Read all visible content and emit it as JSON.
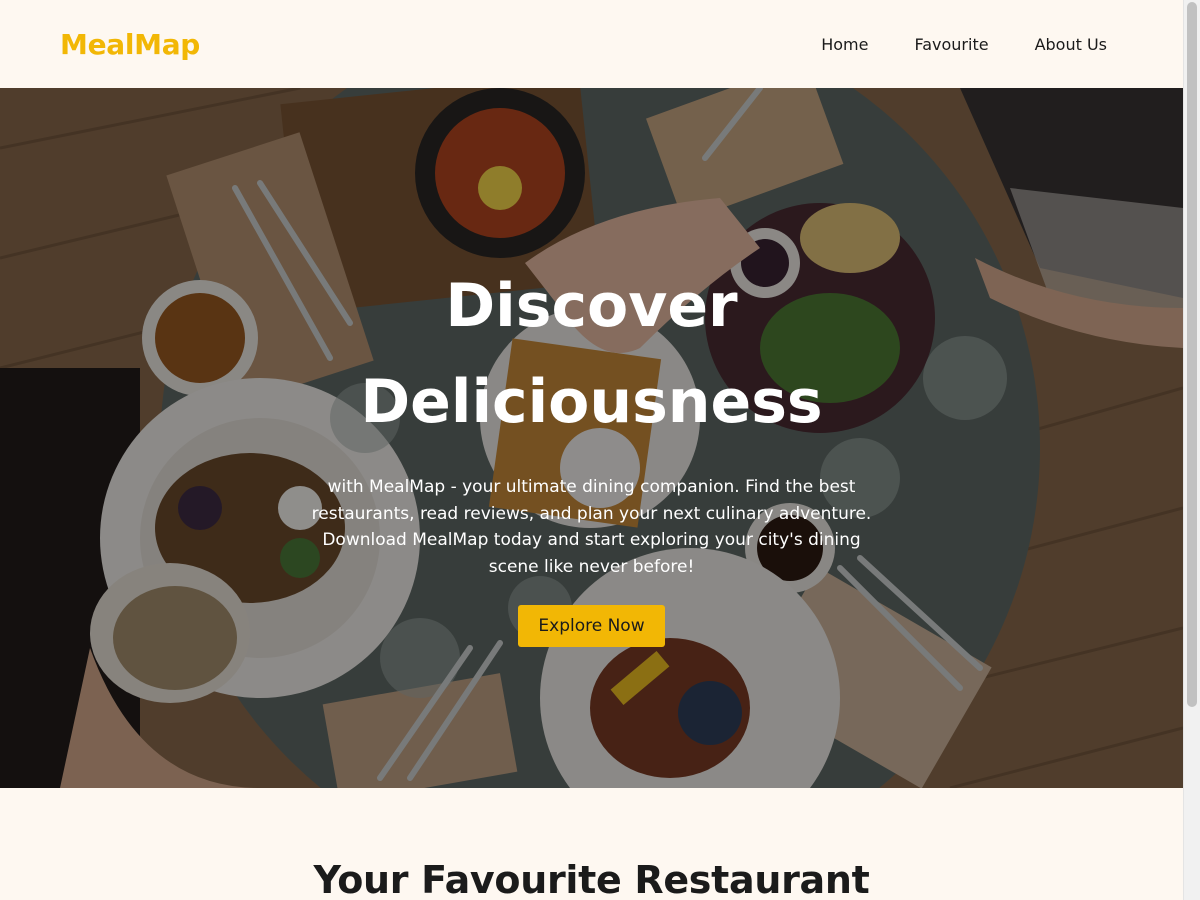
{
  "header": {
    "logo": "MealMap",
    "nav": [
      {
        "label": "Home"
      },
      {
        "label": "Favourite"
      },
      {
        "label": "About Us"
      }
    ]
  },
  "hero": {
    "title_line1": "Discover",
    "title_line2": "Deliciousness",
    "description": "with MealMap - your ultimate dining companion. Find the best restaurants, read reviews, and plan your next culinary adventure. Download MealMap today and start exploring your city's dining scene like never before!",
    "button_label": "Explore Now",
    "image_alt": "overhead view of a breakfast table with plates of food and drinks"
  },
  "favourites": {
    "title": "Your Favourite Restaurant"
  },
  "colors": {
    "accent": "#f2b705",
    "background": "#fef8f1",
    "text": "#1b1b1b"
  }
}
